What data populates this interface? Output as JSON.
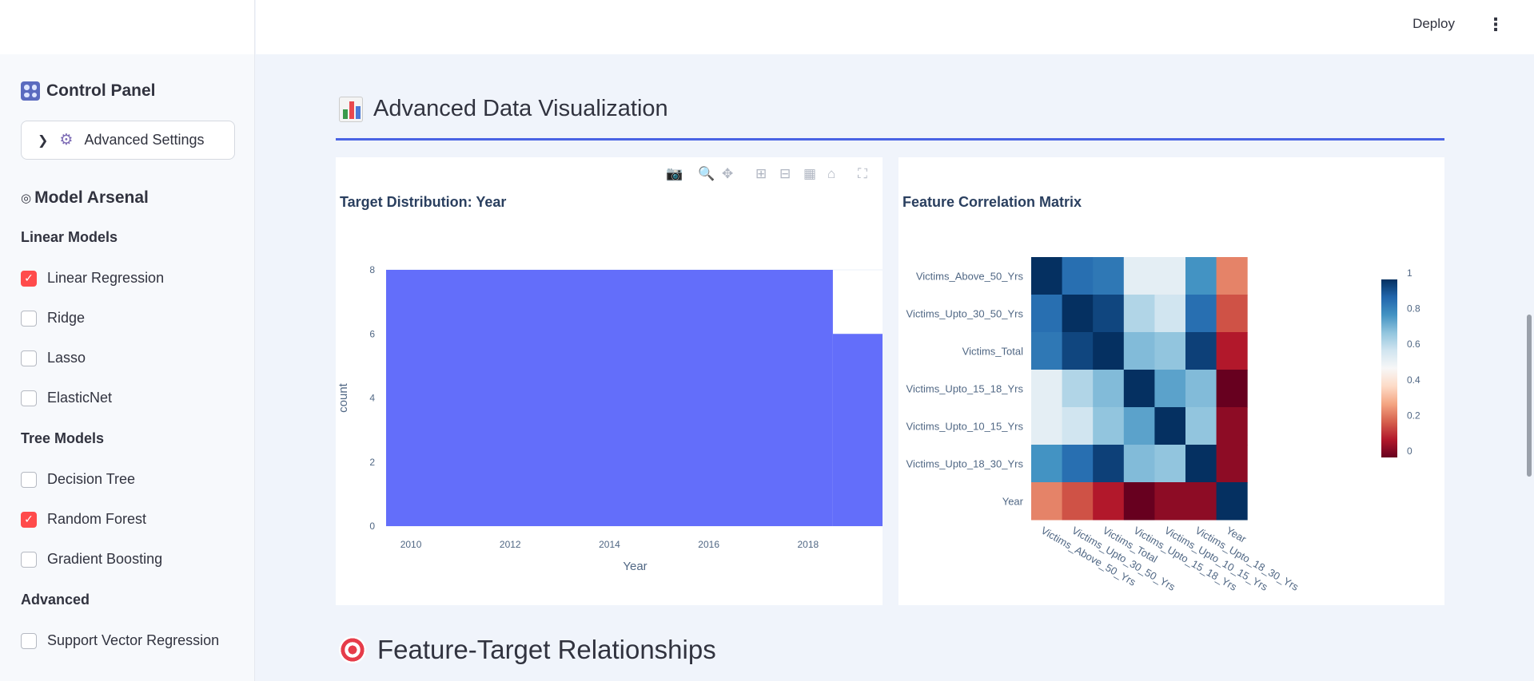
{
  "header": {
    "deploy_label": "Deploy",
    "menu_icon": "kebab-menu-icon"
  },
  "sidebar": {
    "control_panel_title": "Control Panel",
    "advanced_settings_label": "Advanced Settings",
    "model_arsenal_title": "Model Arsenal",
    "sections": {
      "linear": "Linear Models",
      "tree": "Tree Models",
      "advanced": "Advanced"
    },
    "models": {
      "linear_regression": {
        "label": "Linear Regression",
        "checked": true
      },
      "ridge": {
        "label": "Ridge",
        "checked": false
      },
      "lasso": {
        "label": "Lasso",
        "checked": false
      },
      "elasticnet": {
        "label": "ElasticNet",
        "checked": false
      },
      "decision_tree": {
        "label": "Decision Tree",
        "checked": false
      },
      "random_forest": {
        "label": "Random Forest",
        "checked": true
      },
      "gradient_boosting": {
        "label": "Gradient Boosting",
        "checked": false
      },
      "svr": {
        "label": "Support Vector Regression",
        "checked": false
      }
    }
  },
  "main": {
    "section_title": "Advanced Data Visualization",
    "next_section_title": "Feature-Target Relationships"
  },
  "colors": {
    "accent": "#ff4b4b",
    "bar": "#636efa",
    "divider": "#4a63e4"
  },
  "chart_data": [
    {
      "type": "bar",
      "title": "Target Distribution: Year",
      "xlabel": "Year",
      "ylabel": "count",
      "bins": [
        {
          "x0": 2009.5,
          "x1": 2018.5,
          "count": 8
        },
        {
          "x0": 2018.5,
          "x1": 2019.5,
          "count": 6
        }
      ],
      "xticks": [
        "2010",
        "2012",
        "2014",
        "2016",
        "2018"
      ],
      "yticks": [
        "0",
        "2",
        "4",
        "6",
        "8"
      ],
      "xlim": [
        2009.5,
        2019.5
      ],
      "ylim": [
        0,
        8
      ]
    },
    {
      "type": "heatmap",
      "title": "Feature Correlation Matrix",
      "rows": [
        "Victims_Above_50_Yrs",
        "Victims_Upto_30_50_Yrs",
        "Victims_Total",
        "Victims_Upto_15_18_Yrs",
        "Victims_Upto_10_15_Yrs",
        "Victims_Upto_18_30_Yrs",
        "Year"
      ],
      "columns": [
        "Victims_Above_50_Yrs",
        "Victims_Upto_30_50_Yrs",
        "Victims_Total",
        "Victims_Upto_15_18_Yrs",
        "Victims_Upto_10_15_Yrs",
        "Victims_Upto_18_30_Yrs",
        "Year"
      ],
      "values": [
        [
          1.0,
          0.88,
          0.86,
          0.55,
          0.55,
          0.8,
          0.25
        ],
        [
          0.88,
          1.0,
          0.96,
          0.65,
          0.6,
          0.88,
          0.18
        ],
        [
          0.86,
          0.96,
          1.0,
          0.72,
          0.7,
          0.97,
          0.1
        ],
        [
          0.55,
          0.65,
          0.72,
          1.0,
          0.77,
          0.72,
          0.0
        ],
        [
          0.55,
          0.6,
          0.7,
          0.77,
          1.0,
          0.7,
          0.05
        ],
        [
          0.8,
          0.88,
          0.97,
          0.72,
          0.7,
          1.0,
          0.05
        ],
        [
          0.25,
          0.18,
          0.1,
          0.0,
          0.05,
          0.05,
          1.0
        ]
      ],
      "colorbar_ticks": [
        "0",
        "0.2",
        "0.4",
        "0.6",
        "0.8",
        "1"
      ],
      "zlim": [
        0,
        1
      ],
      "colorscale": "RdBu"
    }
  ]
}
